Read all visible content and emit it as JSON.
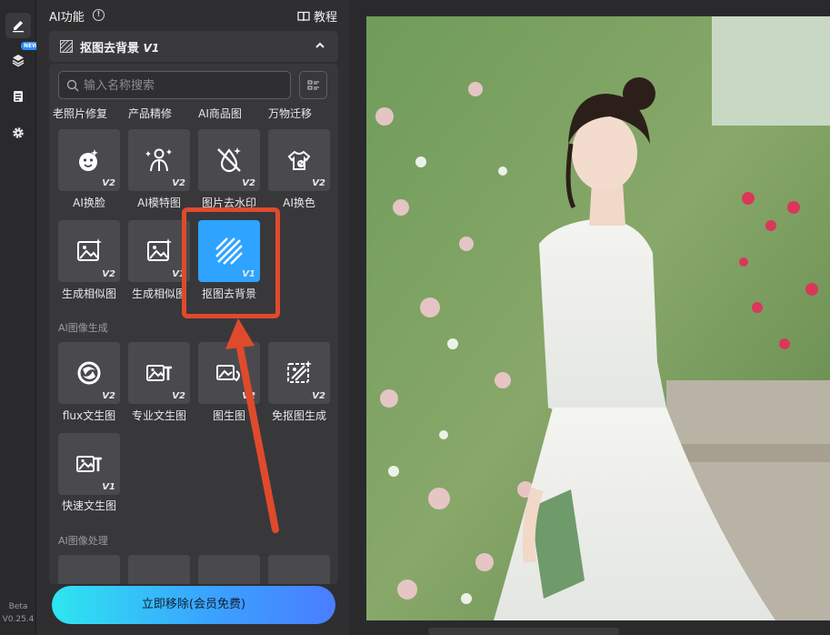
{
  "rail": {
    "new_badge": "NEW",
    "version_line1": "Beta",
    "version_line2": "V0.25.4"
  },
  "panel": {
    "title": "AI功能",
    "info_glyph": "!",
    "tutorial": "教程",
    "section": {
      "name": "抠图去背景",
      "version": "V1"
    },
    "search": {
      "placeholder": "输入名称搜索"
    },
    "top_labels": [
      "老照片修复",
      "产品精修",
      "AI商品图",
      "万物迁移"
    ],
    "tiles": [
      {
        "label": "AI换脸",
        "version": "V2",
        "icon": "face-icon"
      },
      {
        "label": "AI模特图",
        "version": "V2",
        "icon": "model-icon"
      },
      {
        "label": "图片去水印",
        "version": "V2",
        "icon": "watermark-remove-icon"
      },
      {
        "label": "AI换色",
        "version": "V2",
        "icon": "palette-icon"
      },
      {
        "label": "生成相似图",
        "version": "V2",
        "icon": "image-sparkle-icon"
      },
      {
        "label": "生成相似图",
        "version": "V1",
        "icon": "image-sparkle-icon"
      },
      {
        "label": "抠图去背景",
        "version": "V1",
        "icon": "stripes-icon",
        "selected": true
      }
    ],
    "group_gen": {
      "label": "AI图像生成",
      "tiles": [
        {
          "label": "flux文生图",
          "version": "V2",
          "icon": "flux-icon"
        },
        {
          "label": "专业文生图",
          "version": "V2",
          "icon": "text-image-icon"
        },
        {
          "label": "图生图",
          "version": "V2",
          "icon": "image-to-image-icon"
        },
        {
          "label": "免抠图生成",
          "version": "V2",
          "icon": "cutout-gen-icon"
        },
        {
          "label": "快速文生图",
          "version": "V1",
          "icon": "text-image-icon"
        }
      ]
    },
    "group_proc": {
      "label": "AI图像处理"
    },
    "cta": "立即移除(会员免费)"
  },
  "colors": {
    "accent": "#2ea3ff",
    "annotation": "#e04a2c"
  }
}
